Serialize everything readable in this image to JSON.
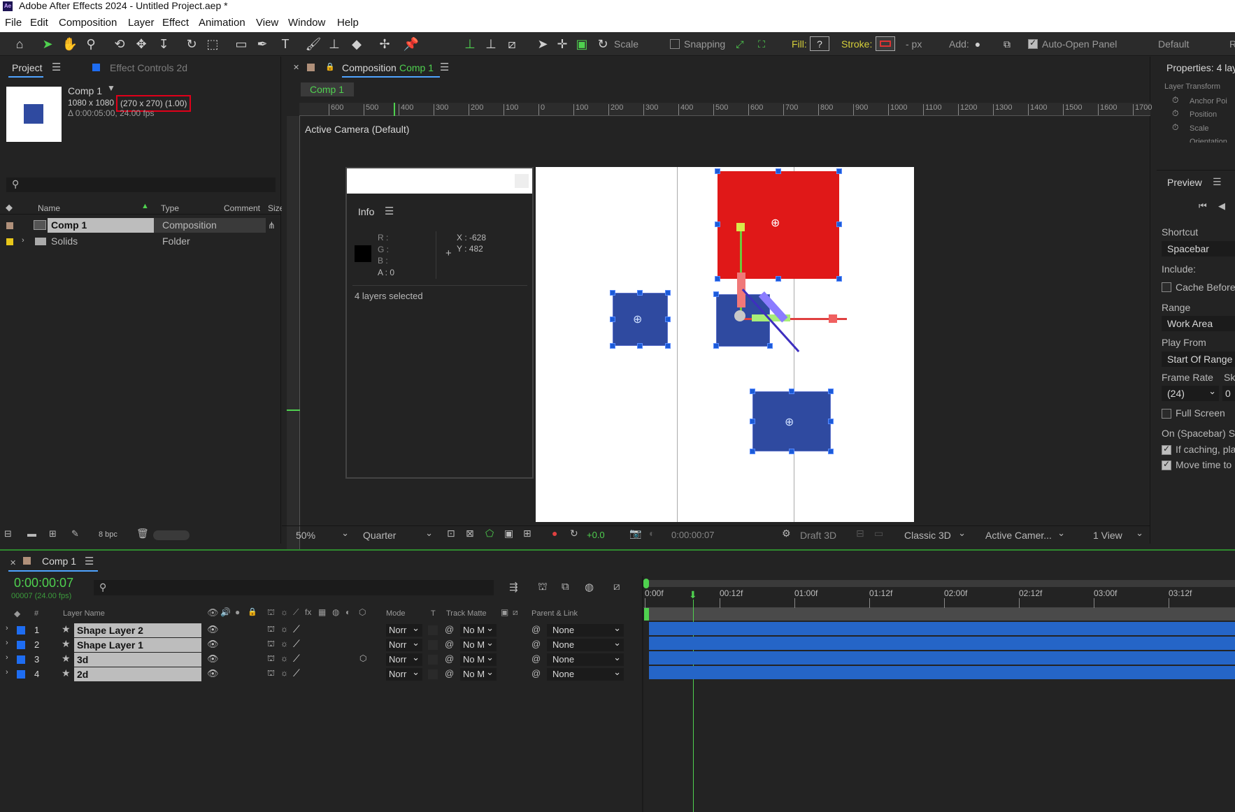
{
  "app": {
    "title": "Adobe After Effects 2024 - Untitled Project.aep *",
    "logo": "Ae"
  },
  "menu": [
    "File",
    "Edit",
    "Composition",
    "Layer",
    "Effect",
    "Animation",
    "View",
    "Window",
    "Help"
  ],
  "toolbar": {
    "scale_label": "Scale",
    "snapping_label": "Snapping",
    "fill_label": "Fill:",
    "fill_value": "?",
    "stroke_label": "Stroke:",
    "stroke_px": "- px",
    "add_label": "Add:",
    "auto_open_label": "Auto-Open Panel",
    "workspace": "Default",
    "workspace_next": "R"
  },
  "project": {
    "tab": "Project",
    "effect_tab": "Effect Controls 2d",
    "comp_name": "Comp 1",
    "comp_size": "1080 x 1080",
    "comp_size_hl": "(270 x 270) (1.00)",
    "comp_duration": "Δ 0:00:05:00, 24.00 fps",
    "columns": {
      "name": "Name",
      "type": "Type",
      "comment": "Comment",
      "size": "Size"
    },
    "items": [
      {
        "name": "Comp 1",
        "type": "Composition"
      },
      {
        "name": "Solids",
        "type": "Folder"
      }
    ],
    "bpc": "8 bpc"
  },
  "composition": {
    "tab_prefix": "Composition",
    "tab_name": "Comp 1",
    "subtab": "Comp 1",
    "camera": "Active Camera (Default)",
    "ruler_labels": [
      "600",
      "500",
      "400",
      "300",
      "200",
      "100",
      "0",
      "100",
      "200",
      "300",
      "400",
      "500",
      "600",
      "700",
      "800",
      "900",
      "1000",
      "1100",
      "1200",
      "1300",
      "1400",
      "1500",
      "1600",
      "1700"
    ],
    "zoom": "50%",
    "resolution": "Quarter",
    "exposure": "+0.0",
    "timecode": "0:00:00:07",
    "draft": "Draft 3D",
    "renderer": "Classic 3D",
    "camera_select": "Active Camer...",
    "view": "1 View"
  },
  "info": {
    "title": "Info",
    "r": "R :",
    "g": "G :",
    "b": "B :",
    "a": "A :  0",
    "x": "X : -628",
    "y": "Y : 482",
    "status": "4 layers selected"
  },
  "properties": {
    "title": "Properties: 4 lay",
    "section": "Layer Transform",
    "items": [
      "Anchor Poi",
      "Position",
      "Scale",
      "Orientation"
    ]
  },
  "preview": {
    "title": "Preview",
    "shortcut_label": "Shortcut",
    "shortcut_value": "Spacebar",
    "include_label": "Include:",
    "cache_before": "Cache Before",
    "range_label": "Range",
    "range_value": "Work Area",
    "play_from_label": "Play From",
    "play_from_value": "Start Of Range",
    "frame_rate_label": "Frame Rate",
    "skip_label": "Ski",
    "frame_rate_value": "(24)",
    "skip_value": "0",
    "full_screen": "Full Screen",
    "on_spacebar": "On (Spacebar) St",
    "if_caching": "If caching, pla",
    "move_time": "Move time to"
  },
  "timeline": {
    "tab": "Comp 1",
    "timecode": "0:00:00:07",
    "frame_info": "00007 (24.00 fps)",
    "columns": {
      "num": "#",
      "layer_name": "Layer Name",
      "mode": "Mode",
      "t": "T",
      "track_matte": "Track Matte",
      "parent": "Parent & Link"
    },
    "ruler": [
      "0:00f",
      "00:12f",
      "01:00f",
      "01:12f",
      "02:00f",
      "02:12f",
      "03:00f",
      "03:12f"
    ],
    "layers": [
      {
        "num": "1",
        "name": "Shape Layer 2",
        "mode": "Norr",
        "matte": "No M",
        "parent": "None"
      },
      {
        "num": "2",
        "name": "Shape Layer 1",
        "mode": "Norr",
        "matte": "No M",
        "parent": "None"
      },
      {
        "num": "3",
        "name": "3d",
        "mode": "Norr",
        "matte": "No M",
        "parent": "None"
      },
      {
        "num": "4",
        "name": "2d",
        "mode": "Norr",
        "matte": "No M",
        "parent": "None"
      }
    ]
  },
  "colors": {
    "accent": "#4fd14f",
    "layer_blue": "#2565c7",
    "red_shape": "#e01818",
    "blue_shape": "#2f4aa0"
  }
}
